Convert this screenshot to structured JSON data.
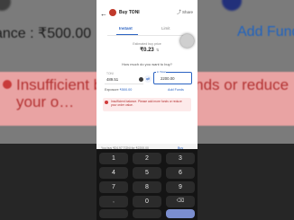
{
  "background": {
    "balance_text": "ance : ₹500.00",
    "add_funds_text": "Add Funds",
    "error_text": "Insufficient ba… d more funds or reduce your o…"
  },
  "header": {
    "title": "Buy TONI",
    "share_label": "Share",
    "back_icon": "arrow-left-icon",
    "share_icon": "share-icon"
  },
  "tabs": [
    {
      "label": "Instant",
      "active": true
    },
    {
      "label": "Limit",
      "active": false
    }
  ],
  "price": {
    "label": "Estimated buy price",
    "value": "₹0.23"
  },
  "order": {
    "question": "How much do you want to buy?",
    "left_caption": "TONI",
    "left_value": "489.51",
    "right_caption": "in Total",
    "right_value": "2200.00"
  },
  "info_row": {
    "exposure_label": "Exposure",
    "exposure_value": "₹500.00",
    "add_funds_label": "Add Funds"
  },
  "alert": {
    "message": "Insufficient balance. Please add more funds or reduce your order value."
  },
  "footer": {
    "summary": "You buy ₹24.97 TONI for ₹2200.00",
    "action": "Buy"
  },
  "keypad": {
    "rows": [
      [
        "1",
        "2",
        "3"
      ],
      [
        "4",
        "5",
        "6"
      ],
      [
        "7",
        "8",
        "9"
      ],
      [
        ",",
        "0",
        "⌫"
      ],
      [
        "",
        "",
        ""
      ]
    ]
  },
  "colors": {
    "accent": "#2a62c2",
    "error": "#b33131",
    "error_bg": "#fdeaea"
  }
}
